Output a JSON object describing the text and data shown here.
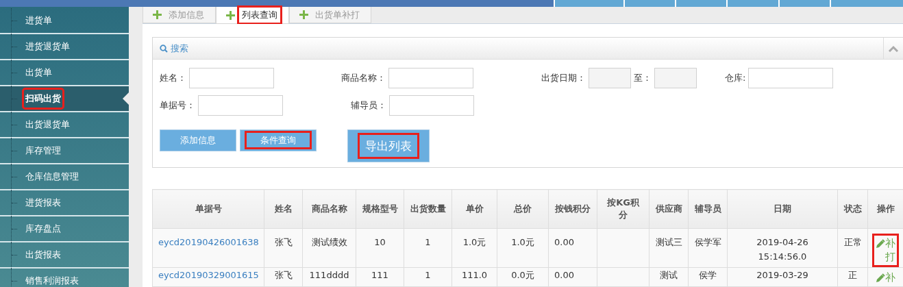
{
  "sidebar": {
    "items": [
      {
        "label": "进货单",
        "selected": false,
        "highlighted": false
      },
      {
        "label": "进货退货单",
        "selected": false,
        "highlighted": false
      },
      {
        "label": "出货单",
        "selected": false,
        "highlighted": false
      },
      {
        "label": "扫码出货",
        "selected": true,
        "highlighted": true
      },
      {
        "label": "出货退货单",
        "selected": false,
        "highlighted": false
      },
      {
        "label": "库存管理",
        "selected": false,
        "highlighted": false
      },
      {
        "label": "仓库信息管理",
        "selected": false,
        "highlighted": false
      },
      {
        "label": "进货报表",
        "selected": false,
        "highlighted": false
      },
      {
        "label": "库存盘点",
        "selected": false,
        "highlighted": false
      },
      {
        "label": "出货报表",
        "selected": false,
        "highlighted": false
      },
      {
        "label": "销售利润报表",
        "selected": false,
        "highlighted": false
      }
    ]
  },
  "tabs": [
    {
      "label": "添加信息",
      "selected": false,
      "highlighted": false
    },
    {
      "label": "列表查询",
      "selected": true,
      "highlighted": true
    },
    {
      "label": "出货单补打",
      "selected": false,
      "highlighted": false
    }
  ],
  "search": {
    "title": "搜索",
    "rows": [
      [
        {
          "kind": "text",
          "label": "姓名："
        },
        {
          "kind": "text",
          "label": "商品名称："
        },
        {
          "kind": "range",
          "label": "出货日期：",
          "separator": "至："
        },
        {
          "kind": "text",
          "label": "仓库:"
        }
      ],
      [
        {
          "kind": "text",
          "label": "单据号："
        },
        {
          "kind": "text",
          "label": "辅导员："
        }
      ]
    ]
  },
  "buttons": [
    {
      "label": "添加信息",
      "kind": "normal",
      "highlighted": false
    },
    {
      "label": "条件查询",
      "kind": "normal",
      "highlighted": true
    },
    {
      "label": "导出列表",
      "kind": "large",
      "highlighted": true
    }
  ],
  "table": {
    "columns": [
      "单据号",
      "姓名",
      "商品名称",
      "规格型号",
      "出货数量",
      "单价",
      "总价",
      "按钱积分",
      "按KG积分",
      "供应商",
      "辅导员",
      "日期",
      "状态",
      "操作"
    ],
    "rows": [
      {
        "cells": [
          "eycd20190426001638",
          "张飞",
          "测试绩效",
          "10",
          "1",
          "1.0元",
          "1.0元",
          "0.00",
          null,
          "测试三",
          "侯学军",
          "2019-04-26 15:14:56.0",
          "正常"
        ],
        "action": "补打",
        "highlighted": true
      },
      {
        "cells": [
          "eycd20190329001615",
          "张飞",
          "111dddd",
          "111",
          "1",
          "111.0",
          "0.0元",
          "0.00",
          null,
          "测试",
          "侯学",
          "2019-03-29",
          "正"
        ],
        "action": "补",
        "highlighted": false
      }
    ]
  }
}
